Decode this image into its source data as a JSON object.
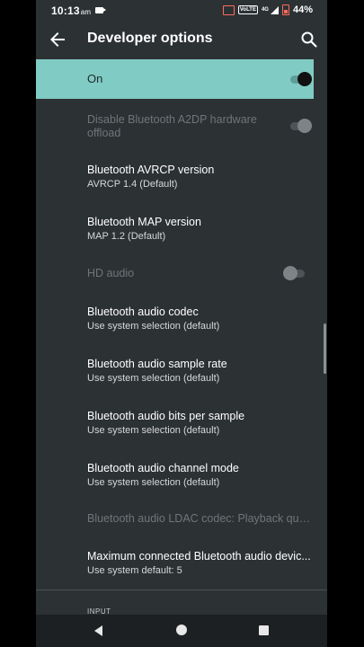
{
  "status_bar": {
    "time": "10:13",
    "ampm": "am",
    "network": "4G",
    "volte": "VoLTE",
    "battery": "44%"
  },
  "toolbar": {
    "title": "Developer options",
    "back_icon": "arrow-back-icon",
    "search_icon": "search-icon"
  },
  "master_switch": {
    "label": "On",
    "checked": true,
    "background": "#80cbc4"
  },
  "settings": [
    {
      "title": "Disable Bluetooth A2DP hardware",
      "title2": "offload",
      "summary": "",
      "enabled": false,
      "toggle": true,
      "toggle_on": false
    },
    {
      "title": "Bluetooth AVRCP version",
      "summary": "AVRCP 1.4 (Default)",
      "enabled": true
    },
    {
      "title": "Bluetooth MAP version",
      "summary": "MAP 1.2 (Default)",
      "enabled": true
    },
    {
      "title": "HD audio",
      "summary": "",
      "enabled": false,
      "toggle": true,
      "toggle_on": false
    },
    {
      "title": "Bluetooth audio codec",
      "summary": "Use system selection (default)",
      "enabled": true
    },
    {
      "title": "Bluetooth audio sample rate",
      "summary": "Use system selection (default)",
      "enabled": true
    },
    {
      "title": "Bluetooth audio bits per sample",
      "summary": "Use system selection (default)",
      "enabled": true
    },
    {
      "title": "Bluetooth audio channel mode",
      "summary": "Use system selection (default)",
      "enabled": true
    },
    {
      "title": "Bluetooth audio LDAC codec: Playback quali...",
      "summary": "",
      "enabled": false
    },
    {
      "title": "Maximum connected Bluetooth audio devic...",
      "summary": "Use system default: 5",
      "enabled": true
    }
  ],
  "section_header": "INPUT",
  "nav_bar": {
    "back_icon": "nav-back-icon",
    "home_icon": "nav-home-icon",
    "recents_icon": "nav-recents-icon"
  },
  "colors": {
    "background": "#2c3134",
    "accent": "#80cbc4",
    "text_primary": "#ffffff",
    "text_disabled": "#6f7578"
  }
}
